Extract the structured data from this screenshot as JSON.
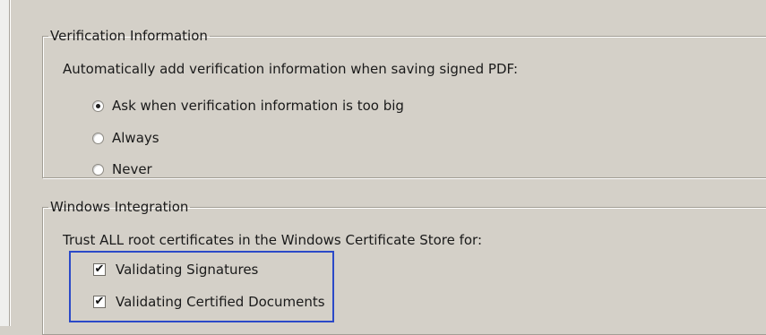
{
  "verification": {
    "legend": "Verification Information",
    "description": "Automatically add verification information when saving signed PDF:",
    "options": [
      {
        "label": "Ask when verification information is too big",
        "selected": true
      },
      {
        "label": "Always",
        "selected": false
      },
      {
        "label": "Never",
        "selected": false
      }
    ]
  },
  "windows_integration": {
    "legend": "Windows Integration",
    "description": "Trust ALL root certificates in the Windows Certificate Store for:",
    "options": [
      {
        "label": "Validating Signatures",
        "checked": true,
        "check_glyph": "✔"
      },
      {
        "label": "Validating Certified Documents",
        "checked": true,
        "check_glyph": "✔"
      }
    ]
  },
  "colors": {
    "dialog_background": "#d4d0c8",
    "highlight_border": "#2b49c8"
  }
}
